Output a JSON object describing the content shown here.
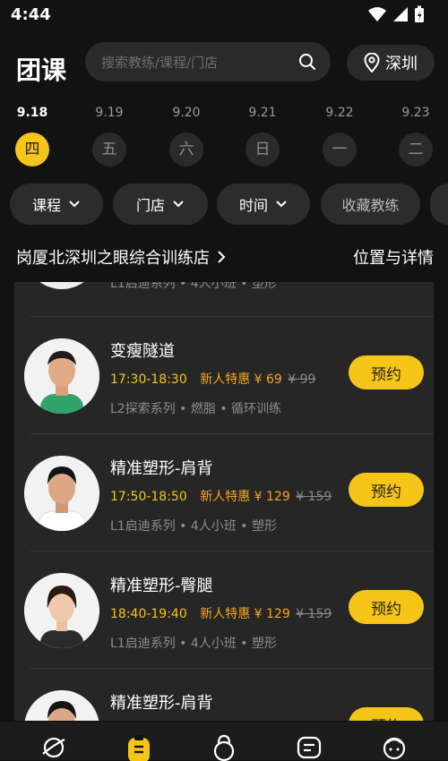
{
  "status": {
    "time": "4:44"
  },
  "header": {
    "title": "团课",
    "search_placeholder": "搜索教练/课程/门店",
    "city": "深圳"
  },
  "dates": [
    {
      "date": "9.18",
      "weekday": "四",
      "selected": true
    },
    {
      "date": "9.19",
      "weekday": "五",
      "selected": false
    },
    {
      "date": "9.20",
      "weekday": "六",
      "selected": false
    },
    {
      "date": "9.21",
      "weekday": "日",
      "selected": false
    },
    {
      "date": "9.22",
      "weekday": "一",
      "selected": false
    },
    {
      "date": "9.23",
      "weekday": "二",
      "selected": false
    }
  ],
  "filters": {
    "course": "课程",
    "store": "门店",
    "time": "时间",
    "favorite_coach": "收藏教练"
  },
  "store": {
    "name": "岗厦北深圳之眼综合训练店",
    "location_details": "位置与详情"
  },
  "classes": [
    {
      "partial": true,
      "tags": "L1启迪系列 • 4人小班 • 塑形"
    },
    {
      "title": "变瘦隧道",
      "time": "17:30-18:30",
      "promo_label": "新人特惠",
      "price": "¥ 69",
      "original_price": "¥ 99",
      "tags": "L2探索系列 • 燃脂 • 循环训练",
      "book_label": "预约",
      "time_color": "#f5c518"
    },
    {
      "title": "精准塑形-肩背",
      "time": "17:50-18:50",
      "promo_label": "新人特惠",
      "price": "¥ 129",
      "original_price": "¥ 159",
      "tags": "L1启迪系列 • 4人小班 • 塑形",
      "book_label": "预约",
      "time_color": "#f5c518"
    },
    {
      "title": "精准塑形-臀腿",
      "time": "18:40-19:40",
      "promo_label": "新人特惠",
      "price": "¥ 129",
      "original_price": "¥ 159",
      "tags": "L1启迪系列 • 4人小班 • 塑形",
      "book_label": "预约",
      "time_color": "#f5c518"
    },
    {
      "title": "精准塑形-肩背",
      "book_label": "预约"
    }
  ],
  "colors": {
    "accent": "#f5c518",
    "promo": "#f5a623",
    "background": "#121212",
    "card": "#262626"
  }
}
